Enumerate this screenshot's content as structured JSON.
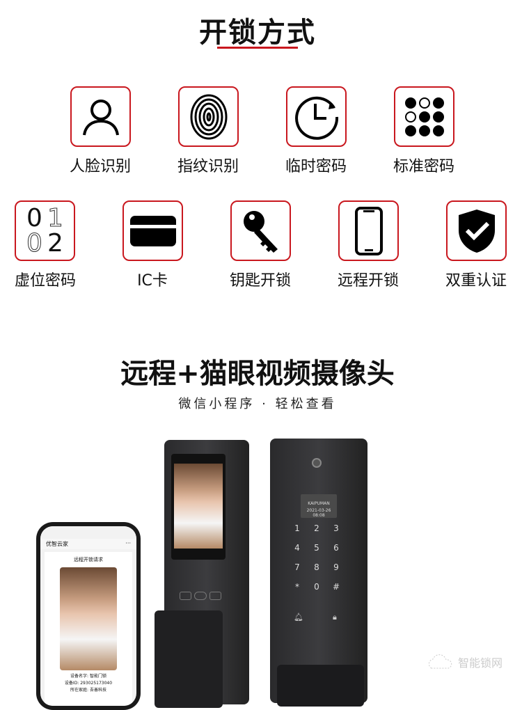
{
  "section1": {
    "title": "开锁方式",
    "methods_row1": [
      {
        "label": "人脸识别",
        "icon": "face-icon"
      },
      {
        "label": "指纹识别",
        "icon": "fingerprint-icon"
      },
      {
        "label": "临时密码",
        "icon": "clock-icon"
      },
      {
        "label": "标准密码",
        "icon": "keypad-dots-icon"
      }
    ],
    "methods_row2": [
      {
        "label": "虚位密码",
        "icon": "virtual-digits-icon",
        "digits": [
          "0",
          "1",
          "0",
          "2"
        ]
      },
      {
        "label": "IC卡",
        "icon": "card-icon"
      },
      {
        "label": "钥匙开锁",
        "icon": "key-icon"
      },
      {
        "label": "远程开锁",
        "icon": "phone-icon"
      },
      {
        "label": "双重认证",
        "icon": "shield-check-icon"
      }
    ]
  },
  "section2": {
    "title": "远程+猫眼视频摄像头",
    "subtitle": "微信小程序 · 轻松查看"
  },
  "phone": {
    "app_name": "优智云家",
    "menu": "···",
    "request_title": "远程开锁请求",
    "device_name": "设备名字: 智能门锁",
    "device_id": "设备ID: 293025173040",
    "family": "所在家庭: 吾善科技"
  },
  "lock": {
    "brand": "KAIPUMAN",
    "datetime": "2021-03-26 08:08",
    "keys": [
      "1",
      "2",
      "3",
      "4",
      "5",
      "6",
      "7",
      "8",
      "9",
      "*",
      "0",
      "#"
    ]
  },
  "watermark": "智能锁网",
  "colors": {
    "accent": "#c9171e"
  }
}
